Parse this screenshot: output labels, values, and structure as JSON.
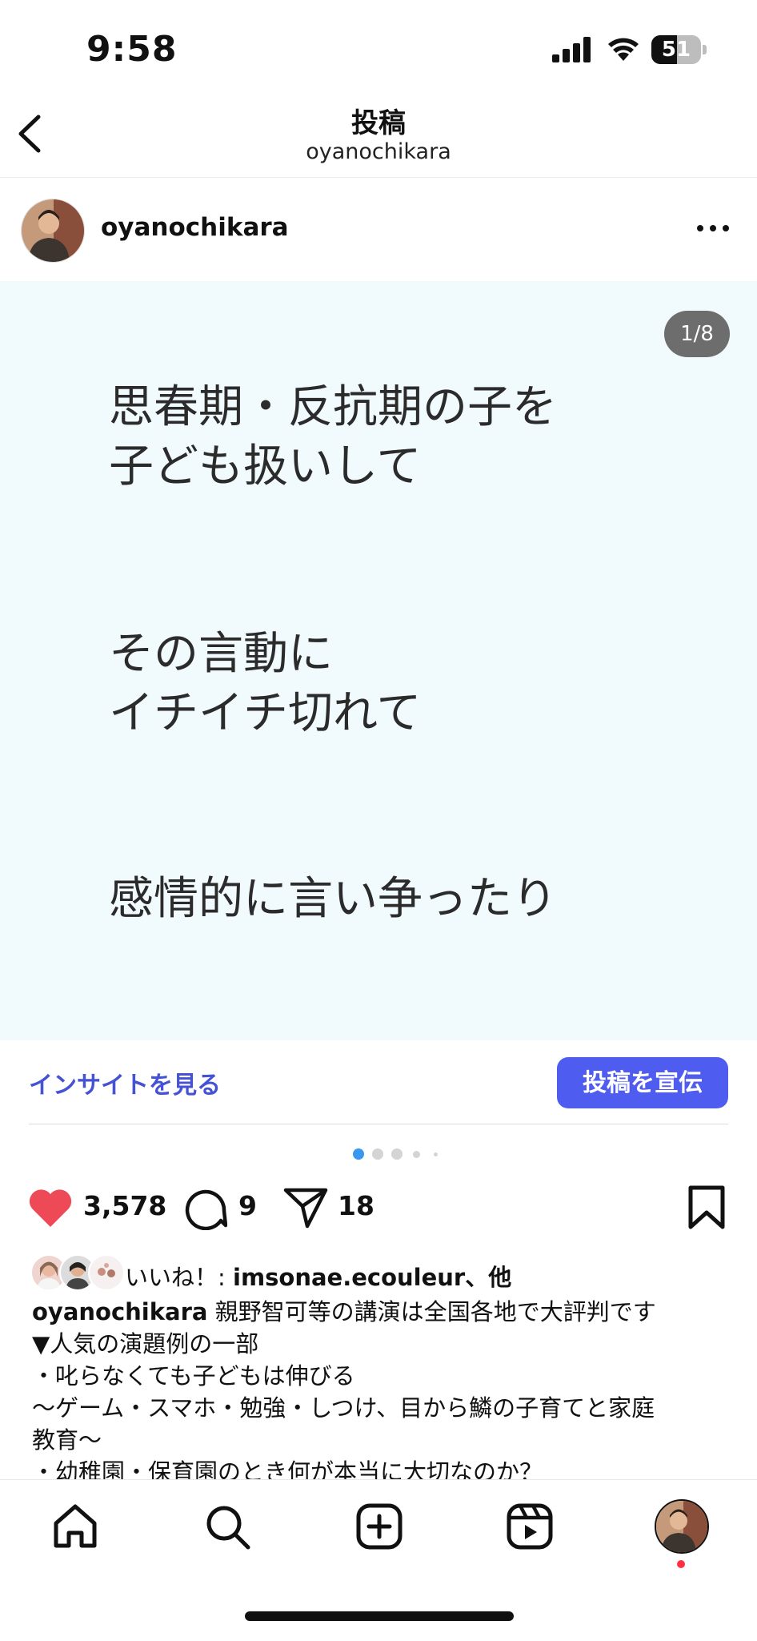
{
  "status_bar": {
    "time": "9:58",
    "battery": "51",
    "battery_level": 0.51
  },
  "header": {
    "title": "投稿",
    "subtitle": "oyanochikara",
    "back_icon": "chevron-left-icon"
  },
  "post": {
    "author": "oyanochikara",
    "more_icon": "more-horizontal-icon",
    "counter": "1/8",
    "image_bg": "#f1fafd",
    "paragraphs": [
      [
        "思春期・反抗期の子を",
        "子ども扱いして"
      ],
      [
        "その言動に",
        "イチイチ切れて"
      ],
      [
        "感情的に言い争ったり"
      ]
    ],
    "carousel": {
      "total": 8,
      "current": 1,
      "active_color": "#3897f0"
    }
  },
  "actions": {
    "insights_label": "インサイトを見る",
    "promote_label": "投稿を宣伝",
    "like_count": "3,578",
    "comment_count": "9",
    "share_count": "18",
    "heart_color": "#ed4956",
    "accent": "#4f5cf0"
  },
  "liked_by": {
    "prefix": "いいね！: ",
    "user": "imsonae.ecouleur",
    "suffix": "、他"
  },
  "caption": {
    "user": "oyanochikara",
    "first": " 親野智可等の講演は全国各地で大評判です",
    "lines": [
      "▼人気の演題例の一部",
      "・叱らなくても子どもは伸びる",
      " 〜ゲーム・スマホ・勉強・しつけ、目から鱗の子育てと家庭",
      "教育〜",
      "・幼稚園・保育園のとき何が本当に大切なのか？"
    ]
  },
  "tabbar": {
    "items": [
      "home-icon",
      "search-icon",
      "create-icon",
      "reels-icon",
      "profile-avatar"
    ]
  }
}
